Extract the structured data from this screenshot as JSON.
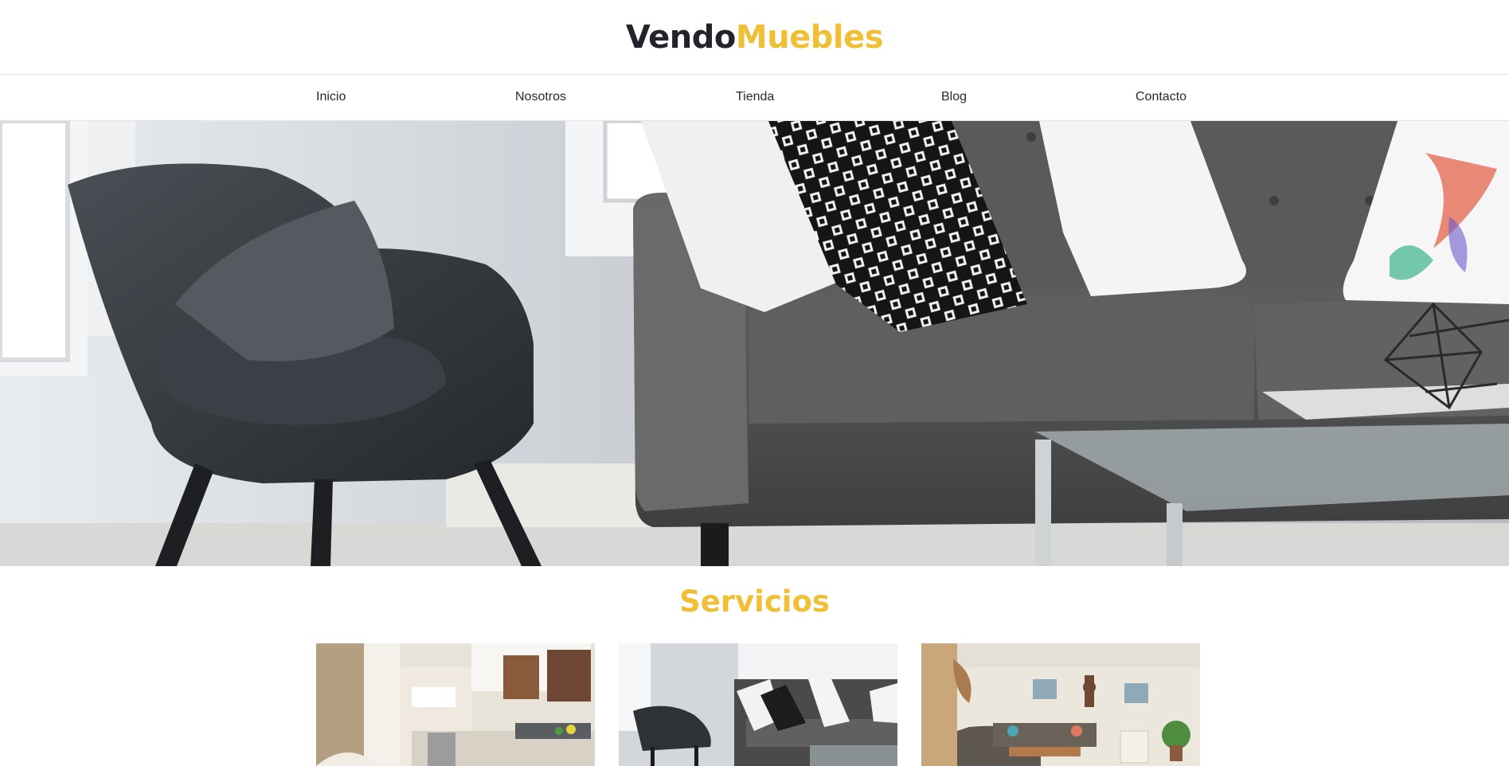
{
  "header": {
    "logo_part1": "Vendo",
    "logo_part2": "Muebles"
  },
  "nav": {
    "items": [
      {
        "label": "Inicio"
      },
      {
        "label": "Nosotros"
      },
      {
        "label": "Tienda"
      },
      {
        "label": "Blog"
      },
      {
        "label": "Contacto"
      }
    ]
  },
  "hero": {
    "image": "living-room-photo"
  },
  "services": {
    "title": "Servicios",
    "cards": [
      {
        "image": "kitchen-photo"
      },
      {
        "image": "living-room-sofa-photo"
      },
      {
        "image": "lounge-room-photo"
      }
    ]
  },
  "colors": {
    "brand_dark": "#23232b",
    "brand_accent": "#f0bf35",
    "border": "#e3e3e3"
  }
}
